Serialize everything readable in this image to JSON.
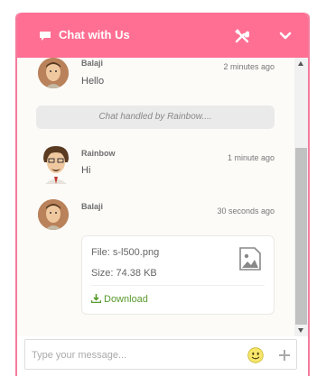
{
  "header": {
    "title": "Chat with Us",
    "chat_icon": "chat-bubble-icon",
    "tools_icon": "tools-icon",
    "collapse_icon": "chevron-down-icon"
  },
  "messages": [
    {
      "sender": "Balaji",
      "time": "2 minutes ago",
      "text": "Hello"
    },
    {
      "system": "Chat handled by Rainbow...."
    },
    {
      "sender": "Rainbow",
      "time": "1 minute ago",
      "text": "Hi"
    },
    {
      "sender": "Balaji",
      "time": "30 seconds ago"
    }
  ],
  "attachment": {
    "file_label": "File: s-l500.png",
    "size_label": "Size: 74.38 KB",
    "download_label": "Download",
    "file_icon": "image-file-icon",
    "download_icon": "download-icon"
  },
  "composer": {
    "placeholder": "Type your message...",
    "emoji_icon": "smiley-icon",
    "attach_icon": "plus-icon"
  },
  "colors": {
    "header": "#ff6f93",
    "border": "#f47b9c",
    "message_bg": "#fcfbf8",
    "download_link": "#5a9a2e"
  }
}
